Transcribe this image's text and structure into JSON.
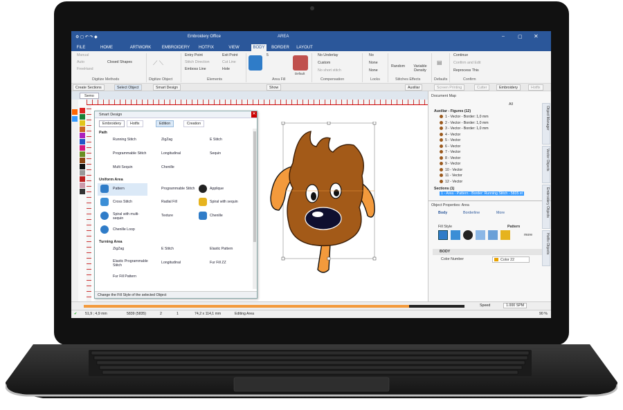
{
  "app": {
    "title": "Embroidery Office",
    "context_tab": "AREA"
  },
  "tabs": [
    "FILE",
    "HOME",
    "ARTWORK",
    "EMBROIDERY",
    "HOTFIX",
    "VIEW",
    "BODY",
    "BORDER",
    "LAYOUT"
  ],
  "ribbon": {
    "digitize_methods": [
      "Manual",
      "Auto",
      "FreeHand",
      "Closed Shapes"
    ],
    "digitize_methods_label": "Digitize Methods",
    "digitize_object_label": "Digitize Object",
    "elements": [
      "Entry Point",
      "Exit Point",
      "Stitch Direction",
      "Cut Line",
      "Emboss Line",
      "Hole"
    ],
    "elements_label": "Elements",
    "area_fill_value": "5",
    "area_fill_label": "Area Fill",
    "default_label": "Default",
    "compensation": [
      "No Underlay",
      "Custom",
      "No short stitch"
    ],
    "compensation_label": "Compensation",
    "locks": [
      "No",
      "None",
      "None"
    ],
    "locks_label": "Locks",
    "stitch_effects": [
      "Random",
      "Variable Density"
    ],
    "stitch_effects_label": "Stitches Effects",
    "defaults_label": "Defaults",
    "confirm": [
      "Continue",
      "Confirm and Edit",
      "Reprocess This"
    ],
    "confirm_label": "Confirm"
  },
  "toolbar": [
    "Create Sections",
    "Select Object",
    "Smart Design",
    "Show",
    "Auxiliar",
    "Screen Printing",
    "Cutter",
    "Embroidery",
    "Hotfix"
  ],
  "doc_tab": "Semo",
  "smart_design": {
    "title": "Smart Design",
    "tabs": [
      "Embroidery",
      "Hotfix"
    ],
    "buttons": [
      "Edition",
      "Creation"
    ],
    "path_title": "Path",
    "path": [
      "Running Stitch",
      "ZigZag",
      "E Stitch",
      "Programmable Stitch",
      "Longitudinal",
      "Sequin",
      "Multi Sequin",
      "Chenille"
    ],
    "uniform_title": "Uniform Area",
    "uniform": [
      "Pattern",
      "Programmable Stitch",
      "Applique",
      "Cross Stitch",
      "Radial Fill",
      "Spiral with sequin",
      "Spiral with multi-sequin",
      "Texture",
      "Chenille",
      "Chenille Loop"
    ],
    "turning_title": "Turning Area",
    "turning": [
      "ZigZag",
      "E Stitch",
      "Elastic Pattern",
      "Elastic Programmable Stitch",
      "Longitudinal",
      "Fur Fill ZZ",
      "Fur Fill Pattern"
    ],
    "status": "Change the Fill Style of the selected Object"
  },
  "document_map": {
    "title": "Document Map",
    "all_label": "All",
    "group1": "Auxiliar - Figures (12)",
    "items": [
      "1 - Vector - Border: 1,0 mm",
      "2 - Vector - Border: 1,0 mm",
      "3 - Vector - Border: 1,0 mm",
      "4 - Vector",
      "5 - Vector",
      "6 - Vector",
      "7 - Vector",
      "8 - Vector",
      "9 - Vector",
      "10 - Vector",
      "11 - Vector",
      "12 - Vector"
    ],
    "group2": "Sections (1)",
    "selected": "1 - Area - Pattern - Border: Running Stitch - 5835 st"
  },
  "properties": {
    "title": "Object Properties: Area",
    "tabs": [
      "Body",
      "Borderline",
      "More"
    ],
    "fill_style": "Fill Style",
    "pattern": "Pattern",
    "more": "more",
    "section": "BODY",
    "color_label": "Color Number",
    "color_value": "Color 22"
  },
  "side_tabs": [
    "Object Manager",
    "Vector Objects",
    "Embroidery Objects",
    "Hotfix Objects"
  ],
  "player": {
    "speed_label": "Speed",
    "speed_value": "1.000 SPM"
  },
  "status": {
    "coords": "51,9 ; 4,9 mm",
    "stitches": "5839 (5835)",
    "colors": "2",
    "objects": "1",
    "size": "74,2 x 114,1 mm",
    "mode": "Editing Area",
    "zoom": "90 %"
  },
  "colors": {
    "accent": "#2b579a",
    "fabric": "#a35a18",
    "ear": "#f39a3c"
  }
}
